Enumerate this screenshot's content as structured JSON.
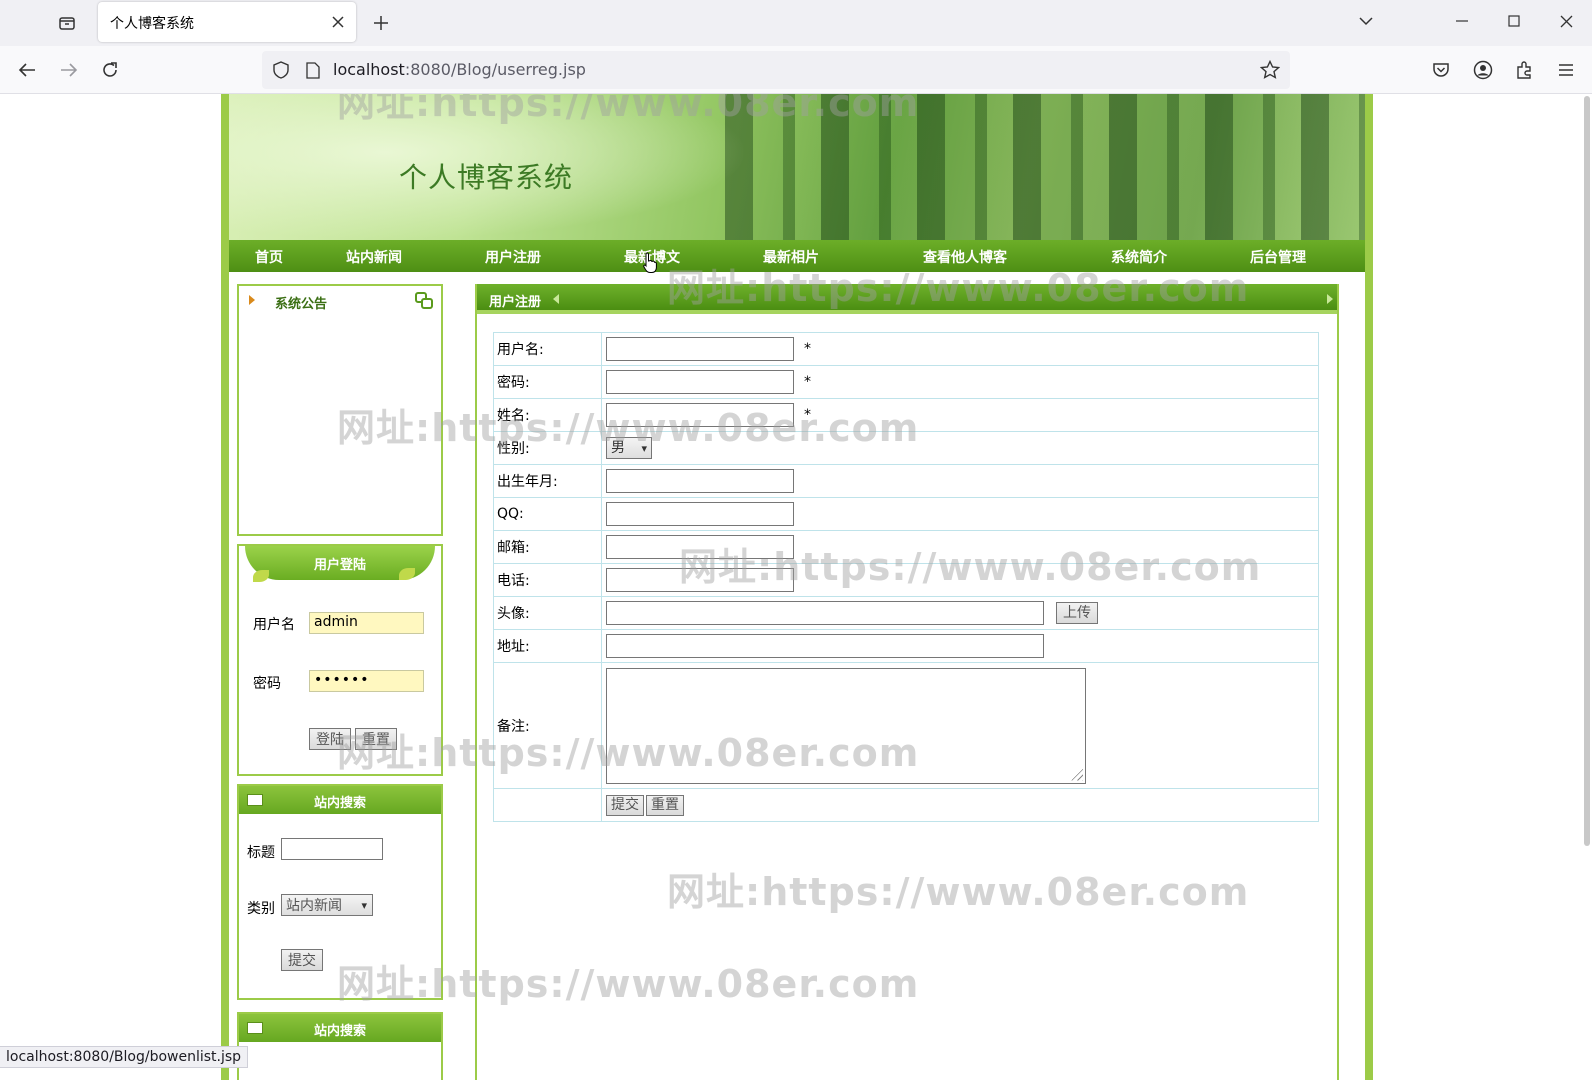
{
  "browser": {
    "tab_title": "个人博客系统",
    "url_host": "localhost",
    "url_rest": ":8080/Blog/userreg.jsp",
    "status_url": "localhost:8080/Blog/bowenlist.jsp"
  },
  "site": {
    "banner_title": "个人博客系统",
    "menu": [
      "首页",
      "站内新闻",
      "用户注册",
      "最新博文",
      "最新相片",
      "查看他人博客",
      "系统简介",
      "后台管理"
    ]
  },
  "sidebar": {
    "notice_title": "系统公告",
    "login": {
      "title": "用户登陆",
      "username_label": "用户名",
      "username_value": "admin",
      "password_label": "密码",
      "password_value": "••••••",
      "login_btn": "登陆",
      "reset_btn": "重置"
    },
    "search": {
      "title": "站内搜索",
      "title_label": "标题",
      "category_label": "类别",
      "category_value": "站内新闻",
      "submit_btn": "提交"
    },
    "search2_title": "站内搜索"
  },
  "main": {
    "title": "用户注册",
    "fields": {
      "username": "用户名:",
      "password": "密码:",
      "realname": "姓名:",
      "gender": "性别:",
      "gender_value": "男",
      "birth": "出生年月:",
      "qq": "QQ:",
      "email": "邮箱:",
      "phone": "电话:",
      "avatar": "头像:",
      "upload_btn": "上传",
      "address": "地址:",
      "remark": "备注:"
    },
    "required_mark": "*",
    "submit_btn": "提交",
    "reset_btn": "重置"
  },
  "watermark": "网址:https://www.08er.com",
  "colors": {
    "theme_green": "#4e8f14",
    "border_green": "#9ccb48"
  }
}
